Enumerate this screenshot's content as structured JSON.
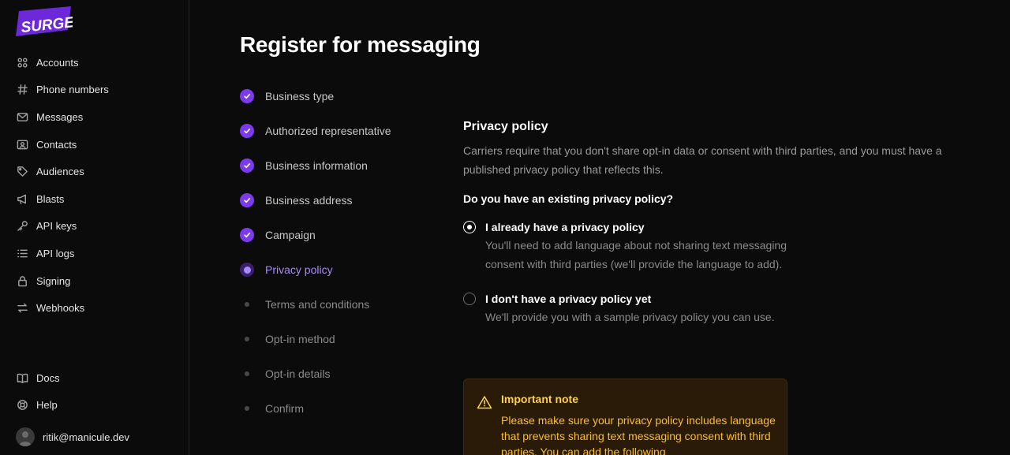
{
  "brand": {
    "logo_text": "SURGE",
    "accent": "#6d28d9"
  },
  "sidebar": {
    "items": [
      {
        "label": "Accounts",
        "icon": "accounts-icon"
      },
      {
        "label": "Phone numbers",
        "icon": "hash-icon"
      },
      {
        "label": "Messages",
        "icon": "envelope-icon"
      },
      {
        "label": "Contacts",
        "icon": "contact-card-icon"
      },
      {
        "label": "Audiences",
        "icon": "tag-icon"
      },
      {
        "label": "Blasts",
        "icon": "megaphone-icon"
      },
      {
        "label": "API keys",
        "icon": "key-icon"
      },
      {
        "label": "API logs",
        "icon": "list-icon"
      },
      {
        "label": "Signing",
        "icon": "lock-icon"
      },
      {
        "label": "Webhooks",
        "icon": "arrows-exchange-icon"
      }
    ],
    "bottom": [
      {
        "label": "Docs",
        "icon": "book-icon"
      },
      {
        "label": "Help",
        "icon": "lifebuoy-icon"
      }
    ],
    "user": {
      "email": "ritik@manicule.dev"
    }
  },
  "main": {
    "title": "Register for messaging",
    "steps": [
      {
        "label": "Business type",
        "state": "complete"
      },
      {
        "label": "Authorized representative",
        "state": "complete"
      },
      {
        "label": "Business information",
        "state": "complete"
      },
      {
        "label": "Business address",
        "state": "complete"
      },
      {
        "label": "Campaign",
        "state": "complete"
      },
      {
        "label": "Privacy policy",
        "state": "current"
      },
      {
        "label": "Terms and conditions",
        "state": "upcoming"
      },
      {
        "label": "Opt-in method",
        "state": "upcoming"
      },
      {
        "label": "Opt-in details",
        "state": "upcoming"
      },
      {
        "label": "Confirm",
        "state": "upcoming"
      }
    ],
    "section": {
      "title": "Privacy policy",
      "description": "Carriers require that you don't share opt-in data or consent with third parties, and you must have a published privacy policy that reflects this.",
      "question": "Do you have an existing privacy policy?",
      "options": [
        {
          "title": "I already have a privacy policy",
          "description": "You'll need to add language about not sharing text messaging consent with third parties (we'll provide the language to add).",
          "selected": true
        },
        {
          "title": "I don't have a privacy policy yet",
          "description": "We'll provide you with a sample privacy policy you can use.",
          "selected": false
        }
      ]
    },
    "note": {
      "title": "Important note",
      "body": "Please make sure your privacy policy includes language that prevents sharing text messaging consent with third parties. You can add the following"
    }
  }
}
